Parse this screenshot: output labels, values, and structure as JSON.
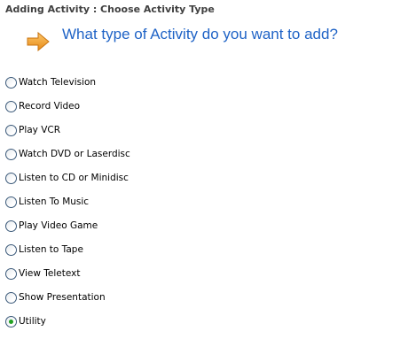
{
  "header": {
    "title": "Adding Activity : Choose Activity Type"
  },
  "question": {
    "text": "What type of Activity do you want to add?",
    "icon": "arrow-right-icon",
    "color": "#1f63c6"
  },
  "options": [
    {
      "label": "Watch Television",
      "checked": false
    },
    {
      "label": "Record Video",
      "checked": false
    },
    {
      "label": "Play VCR",
      "checked": false
    },
    {
      "label": "Watch DVD or Laserdisc",
      "checked": false
    },
    {
      "label": "Listen to CD or Minidisc",
      "checked": false
    },
    {
      "label": "Listen To Music",
      "checked": false
    },
    {
      "label": "Play Video Game",
      "checked": false
    },
    {
      "label": "Listen to Tape",
      "checked": false
    },
    {
      "label": "View Teletext",
      "checked": false
    },
    {
      "label": "Show Presentation",
      "checked": false
    },
    {
      "label": "Utility",
      "checked": true
    }
  ],
  "colors": {
    "arrow": "#f0a030",
    "radio_selected": "#21a121"
  }
}
